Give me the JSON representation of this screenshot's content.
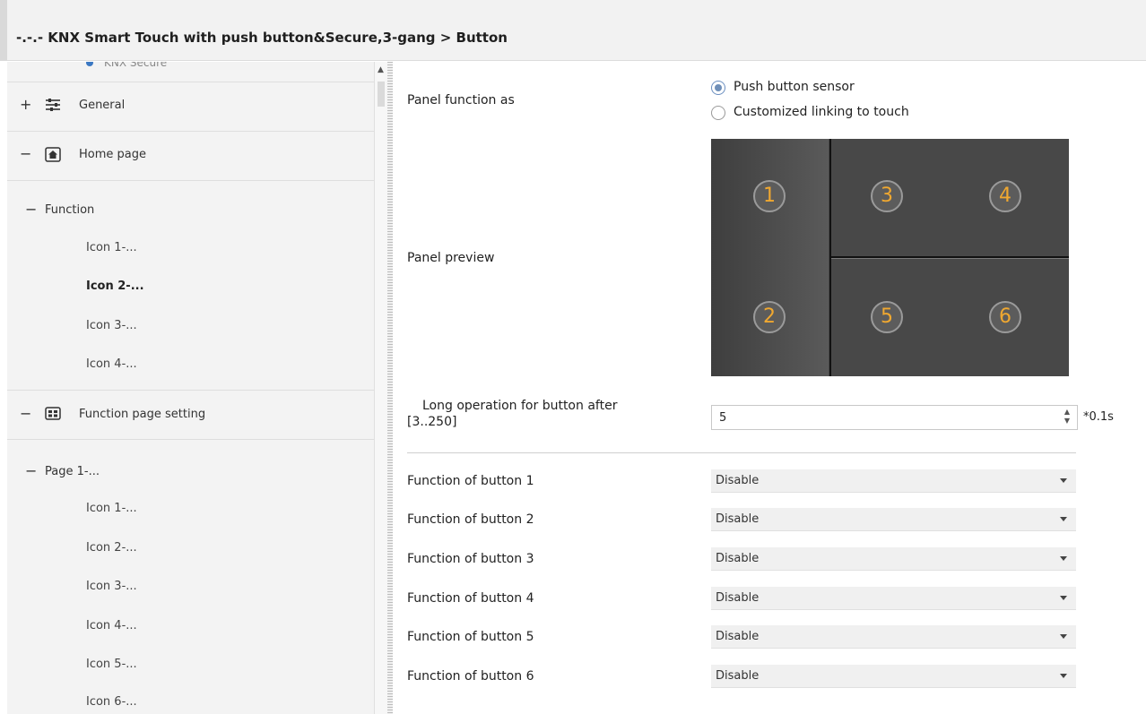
{
  "window": {
    "title": "-.-.- KNX Smart Touch with push button&Secure,3-gang > Button"
  },
  "sidebar": {
    "cut_item": "KNX Secure",
    "sections": [
      {
        "sign": "+",
        "icon": "sliders-icon",
        "label": "General"
      },
      {
        "sign": "−",
        "icon": "home-icon",
        "label": "Home page"
      },
      {
        "sign": "−",
        "icon": "grid-icon",
        "label": "Function page setting"
      }
    ],
    "function_group": {
      "sign": "−",
      "label": "Function"
    },
    "function_items": [
      "Icon 1-...",
      "Icon 2-...",
      "Icon 3-...",
      "Icon 4-..."
    ],
    "page_group": {
      "sign": "−",
      "label": "Page 1-..."
    },
    "page_items": [
      "Icon 1-...",
      "Icon 2-...",
      "Icon 3-...",
      "Icon 4-...",
      "Icon 5-...",
      "Icon 6-..."
    ]
  },
  "main": {
    "panel_function_label": "Panel function as",
    "panel_function_options": [
      {
        "label": "Push button sensor",
        "selected": true
      },
      {
        "label": "Customized linking to touch",
        "selected": false
      }
    ],
    "panel_preview_label": "Panel preview",
    "panel_buttons": [
      "1",
      "2",
      "3",
      "4",
      "5",
      "6"
    ],
    "long_operation_label_line1": "Long operation for button after",
    "long_operation_label_line2": "[3..250]",
    "long_operation_value": "5",
    "long_operation_unit": "*0.1s",
    "button_functions": [
      {
        "label": "Function of button 1",
        "value": "Disable"
      },
      {
        "label": "Function of button 2",
        "value": "Disable"
      },
      {
        "label": "Function of button 3",
        "value": "Disable"
      },
      {
        "label": "Function of button 4",
        "value": "Disable"
      },
      {
        "label": "Function of button 5",
        "value": "Disable"
      },
      {
        "label": "Function of button 6",
        "value": "Disable"
      }
    ]
  },
  "colors": {
    "panel_bg": "#484848",
    "panel_number": "#f0a830",
    "radio_selected": "#6f8fb8",
    "sidebar_bg": "#f3f3f3"
  }
}
